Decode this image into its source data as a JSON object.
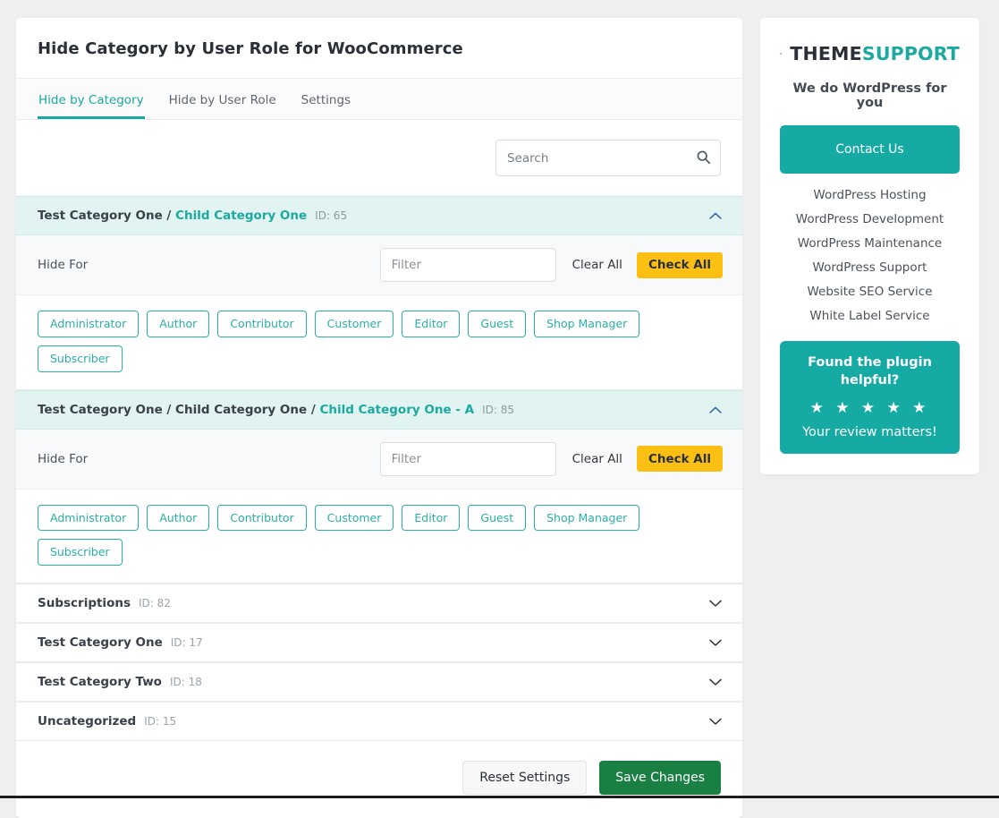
{
  "header": {
    "title": "Hide Category by User Role for WooCommerce"
  },
  "tabs": [
    {
      "label": "Hide by Category",
      "active": true
    },
    {
      "label": "Hide by User Role",
      "active": false
    },
    {
      "label": "Settings",
      "active": false
    }
  ],
  "search": {
    "placeholder": "Search",
    "value": "",
    "icon": "search-icon"
  },
  "controls": {
    "hide_for_label": "Hide For",
    "filter_placeholder": "Filter",
    "filter_value": "",
    "clear_all_label": "Clear All",
    "check_all_label": "Check All"
  },
  "roles": [
    "Administrator",
    "Author",
    "Contributor",
    "Customer",
    "Editor",
    "Guest",
    "Shop Manager",
    "Subscriber"
  ],
  "categories": [
    {
      "path": "Test Category One / ",
      "leaf": "Child Category One",
      "id_label": "ID: 65",
      "expanded": true,
      "chevron": "chevron-up-icon"
    },
    {
      "path": "Test Category One / Child Category One / ",
      "leaf": "Child Category One - A",
      "id_label": "ID: 85",
      "expanded": true,
      "chevron": "chevron-up-icon"
    },
    {
      "path": "",
      "leaf": "Subscriptions",
      "id_label": "ID: 82",
      "expanded": false,
      "chevron": "chevron-down-icon"
    },
    {
      "path": "",
      "leaf": "Test Category One",
      "id_label": "ID: 17",
      "expanded": false,
      "chevron": "chevron-down-icon"
    },
    {
      "path": "",
      "leaf": "Test Category Two",
      "id_label": "ID: 18",
      "expanded": false,
      "chevron": "chevron-down-icon"
    },
    {
      "path": "",
      "leaf": "Uncategorized",
      "id_label": "ID: 15",
      "expanded": false,
      "chevron": "chevron-down-icon"
    }
  ],
  "footer": {
    "reset_label": "Reset Settings",
    "save_label": "Save Changes"
  },
  "sidebar": {
    "brand_first": "THEME",
    "brand_second": "SUPPORT",
    "logo_icon": "themesupport-asterisk-logo-icon",
    "tagline": "We do WordPress for you",
    "contact_label": "Contact Us",
    "links": [
      "WordPress Hosting",
      "WordPress Development",
      "WordPress Maintenance",
      "WordPress Support",
      "Website SEO Service",
      "White Label Service"
    ],
    "review": {
      "title": "Found the plugin helpful?",
      "stars": "★ ★ ★ ★ ★",
      "subtitle": "Your review matters!"
    }
  },
  "colors": {
    "teal": "#1ba9a0",
    "teal_button": "#15aaa4",
    "amber": "#fcc014",
    "green": "#1a7f43",
    "expanded_row": "#e2f4f2",
    "page_bg": "#efefef"
  }
}
